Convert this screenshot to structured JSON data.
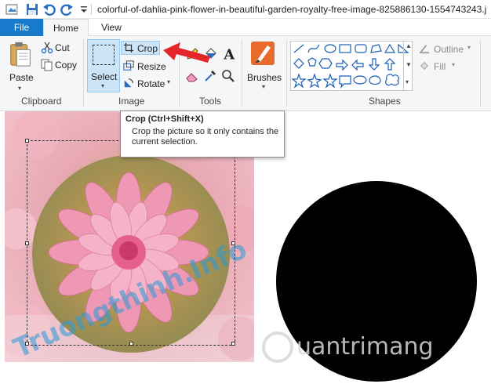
{
  "window": {
    "title": "colorful-of-dahlia-pink-flower-in-beautiful-garden-royalty-free-image-825886130-1554743243.j"
  },
  "menu": {
    "file": "File",
    "home": "Home",
    "view": "View"
  },
  "ribbon": {
    "clipboard": {
      "paste": "Paste",
      "cut": "Cut",
      "copy": "Copy",
      "group_label": "Clipboard"
    },
    "image": {
      "select": "Select",
      "crop": "Crop",
      "resize": "Resize",
      "rotate": "Rotate",
      "group_label": "Image"
    },
    "tools": {
      "group_label": "Tools"
    },
    "brushes": {
      "label": "Brushes"
    },
    "shapes": {
      "outline": "Outline",
      "fill": "Fill",
      "group_label": "Shapes"
    }
  },
  "tooltip": {
    "title": "Crop (Ctrl+Shift+X)",
    "body": "Crop the picture so it only contains the current selection."
  },
  "watermarks": {
    "left": "Truongthinh.Info",
    "right": "uantrimang"
  },
  "colors": {
    "file_tab": "#1979ca",
    "ribbon_bg": "#f5f6f7",
    "arrow": "#e3262b",
    "selected_tool": "#cce4f7"
  }
}
